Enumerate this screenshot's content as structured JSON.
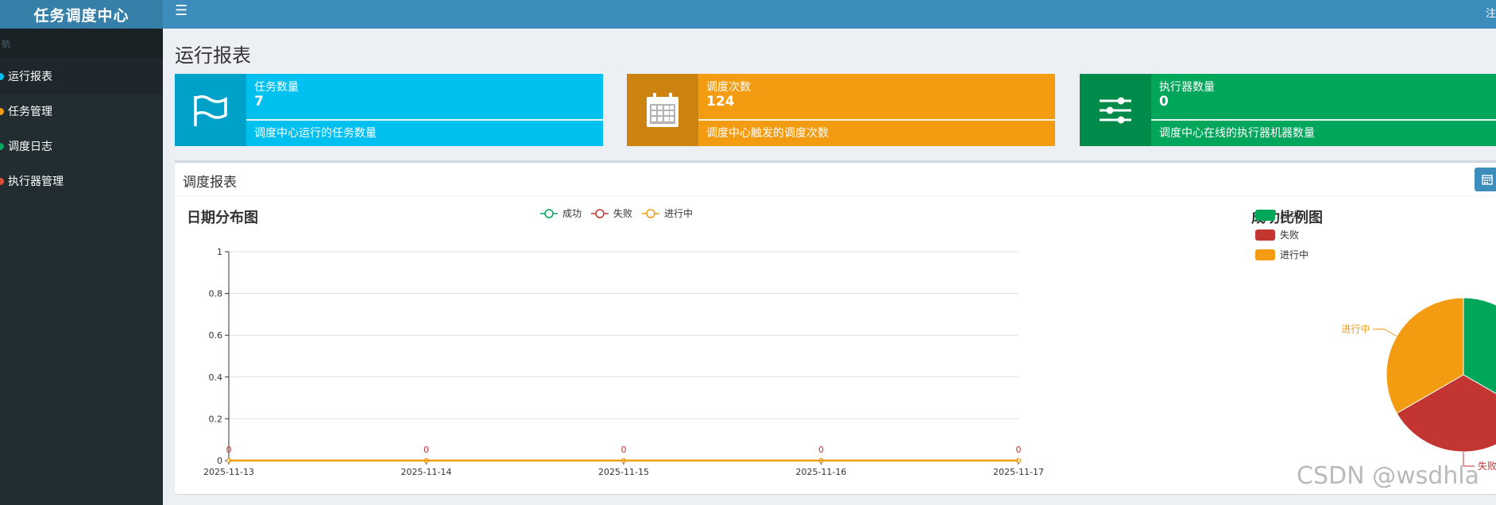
{
  "app": {
    "title": "任务调度中心",
    "nav_header": "航",
    "header_right": "注"
  },
  "sidebar": {
    "items": [
      {
        "label": "运行报表",
        "dot": "#00c0ef",
        "active": true
      },
      {
        "label": "任务管理",
        "dot": "#f39c12",
        "active": false
      },
      {
        "label": "调度日志",
        "dot": "#00a65a",
        "active": false
      },
      {
        "label": "执行器管理",
        "dot": "#dd4b39",
        "active": false
      }
    ]
  },
  "page": {
    "title": "运行报表"
  },
  "info_boxes": [
    {
      "title": "任务数量",
      "value": "7",
      "desc": "调度中心运行的任务数量",
      "color": "#00c0ef",
      "icon": "flag-icon"
    },
    {
      "title": "调度次数",
      "value": "124",
      "desc": "调度中心触发的调度次数",
      "color": "#f39c12",
      "icon": "calendar-icon"
    },
    {
      "title": "执行器数量",
      "value": "0",
      "desc": "调度中心在线的执行器机器数量",
      "color": "#00a65a",
      "icon": "sliders-icon"
    }
  ],
  "report": {
    "title": "调度报表",
    "button_icon": "calendar-icon"
  },
  "chart_data": [
    {
      "type": "line",
      "title": "日期分布图",
      "x": [
        "2025-11-13",
        "2025-11-14",
        "2025-11-15",
        "2025-11-16",
        "2025-11-17"
      ],
      "yticks": [
        "0",
        "0.2",
        "0.4",
        "0.6",
        "0.8",
        "1"
      ],
      "ylim": [
        0,
        1
      ],
      "grid": true,
      "legend_position": "top",
      "series": [
        {
          "name": "成功",
          "values": [
            0,
            0,
            0,
            0,
            0
          ],
          "color": "#00a65a"
        },
        {
          "name": "失败",
          "values": [
            0,
            0,
            0,
            0,
            0
          ],
          "color": "#c23531"
        },
        {
          "name": "进行中",
          "values": [
            0,
            0,
            0,
            0,
            0
          ],
          "color": "#f39c12"
        }
      ],
      "data_labels": [
        "0",
        "0",
        "0",
        "0",
        "0"
      ]
    },
    {
      "type": "pie",
      "title": "成功比例图",
      "legend_position": "top-left",
      "slices": [
        {
          "name": "成功",
          "value": 1,
          "color": "#00a65a"
        },
        {
          "name": "失败",
          "value": 1,
          "color": "#c23531"
        },
        {
          "name": "进行中",
          "value": 1,
          "color": "#f39c12"
        }
      ]
    }
  ],
  "watermark": "CSDN @wsdhla"
}
